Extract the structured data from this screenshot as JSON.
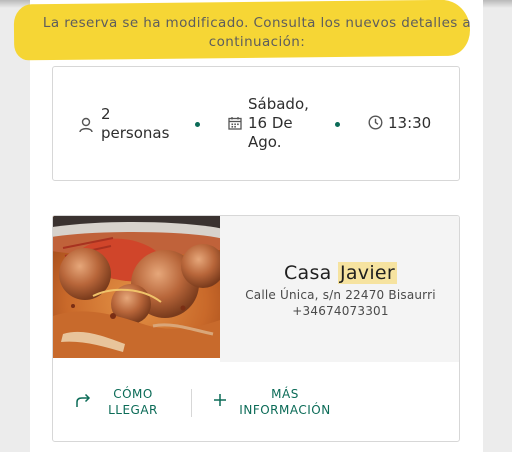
{
  "notice": {
    "text": "La reserva se ha modificado. Consulta los nuevos detalles a continuación:"
  },
  "booking": {
    "guests": "2 personas",
    "date": "Sábado, 16 De Ago.",
    "time": "13:30"
  },
  "restaurant": {
    "name_prefix": "Casa ",
    "name_highlight": "Javier",
    "address": "Calle Única, s/n 22470 Bisaurri",
    "phone": "+34674073301"
  },
  "actions": {
    "directions_label": "CÓMO LLEGAR",
    "more_info_label": "MÁS INFORMACIÓN"
  },
  "colors": {
    "accent": "#0b6b57",
    "highlight": "#f5d42a"
  },
  "icons": {
    "guests": "person-icon",
    "date": "calendar-icon",
    "time": "clock-icon",
    "directions": "share-arrow-icon",
    "more_info": "plus-icon"
  }
}
